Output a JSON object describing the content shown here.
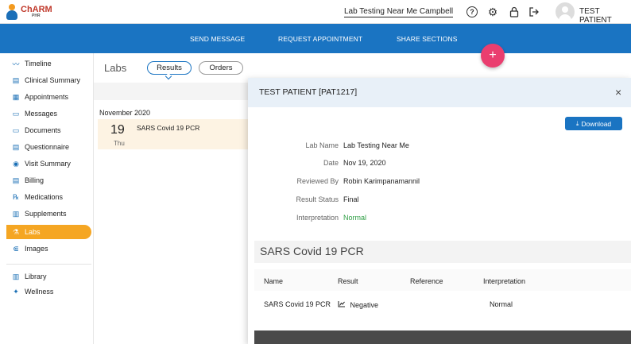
{
  "header": {
    "brand": "ChARM",
    "brand_sub": "PHR",
    "location": "Lab Testing Near Me Campbell",
    "help_icon": "?",
    "patient_name": "TEST PATIENT"
  },
  "navbar": {
    "send_message": "SEND MESSAGE",
    "request_appointment": "REQUEST APPOINTMENT",
    "share_sections": "SHARE SECTIONS",
    "fab": "+"
  },
  "sidebar": {
    "items": [
      {
        "label": "Timeline",
        "icon": "timeline-icon",
        "glyph": "〰"
      },
      {
        "label": "Clinical Summary",
        "icon": "clipboard-icon",
        "glyph": "▤"
      },
      {
        "label": "Appointments",
        "icon": "calendar-icon",
        "glyph": "▦"
      },
      {
        "label": "Messages",
        "icon": "message-icon",
        "glyph": "▭"
      },
      {
        "label": "Documents",
        "icon": "folder-icon",
        "glyph": "▭"
      },
      {
        "label": "Questionnaire",
        "icon": "questionnaire-icon",
        "glyph": "▤"
      },
      {
        "label": "Visit Summary",
        "icon": "visit-summary-icon",
        "glyph": "◉"
      },
      {
        "label": "Billing",
        "icon": "billing-icon",
        "glyph": "▤"
      },
      {
        "label": "Medications",
        "icon": "rx-icon",
        "glyph": "℞"
      },
      {
        "label": "Supplements",
        "icon": "supplements-icon",
        "glyph": "▥"
      },
      {
        "label": "Labs",
        "icon": "flask-icon",
        "glyph": "⚗"
      },
      {
        "label": "Images",
        "icon": "images-icon",
        "glyph": "⋐"
      },
      {
        "label": "Library",
        "icon": "library-icon",
        "glyph": "▥"
      },
      {
        "label": "Wellness",
        "icon": "wellness-icon",
        "glyph": "✦"
      }
    ],
    "active": "Labs"
  },
  "main": {
    "title": "Labs",
    "tabs": {
      "results": "Results",
      "orders": "Orders"
    },
    "month": "November 2020",
    "result": {
      "day": "19",
      "dow": "Thu",
      "name": "SARS Covid 19 PCR"
    }
  },
  "panel": {
    "title": "TEST PATIENT [PAT1217]",
    "close": "×",
    "download": "Download",
    "fields": {
      "lab_name_label": "Lab Name",
      "lab_name": "Lab Testing Near Me",
      "date_label": "Date",
      "date": "Nov 19, 2020",
      "reviewed_by_label": "Reviewed By",
      "reviewed_by": "Robin Karimpanamannil",
      "status_label": "Result Status",
      "status": "Final",
      "interpretation_label": "Interpretation",
      "interpretation": "Normal"
    },
    "section_title": "SARS Covid 19 PCR",
    "table": {
      "headers": {
        "name": "Name",
        "result": "Result",
        "reference": "Reference",
        "interpretation": "Interpretation"
      },
      "row": {
        "name": "SARS Covid 19 PCR",
        "result": "Negative",
        "reference": "",
        "interpretation": "Normal"
      }
    }
  },
  "colors": {
    "navbar": "#1a74c2",
    "active_item": "#f5a623",
    "fab": "#ea3e6f",
    "normal_green": "#2e9e44"
  }
}
